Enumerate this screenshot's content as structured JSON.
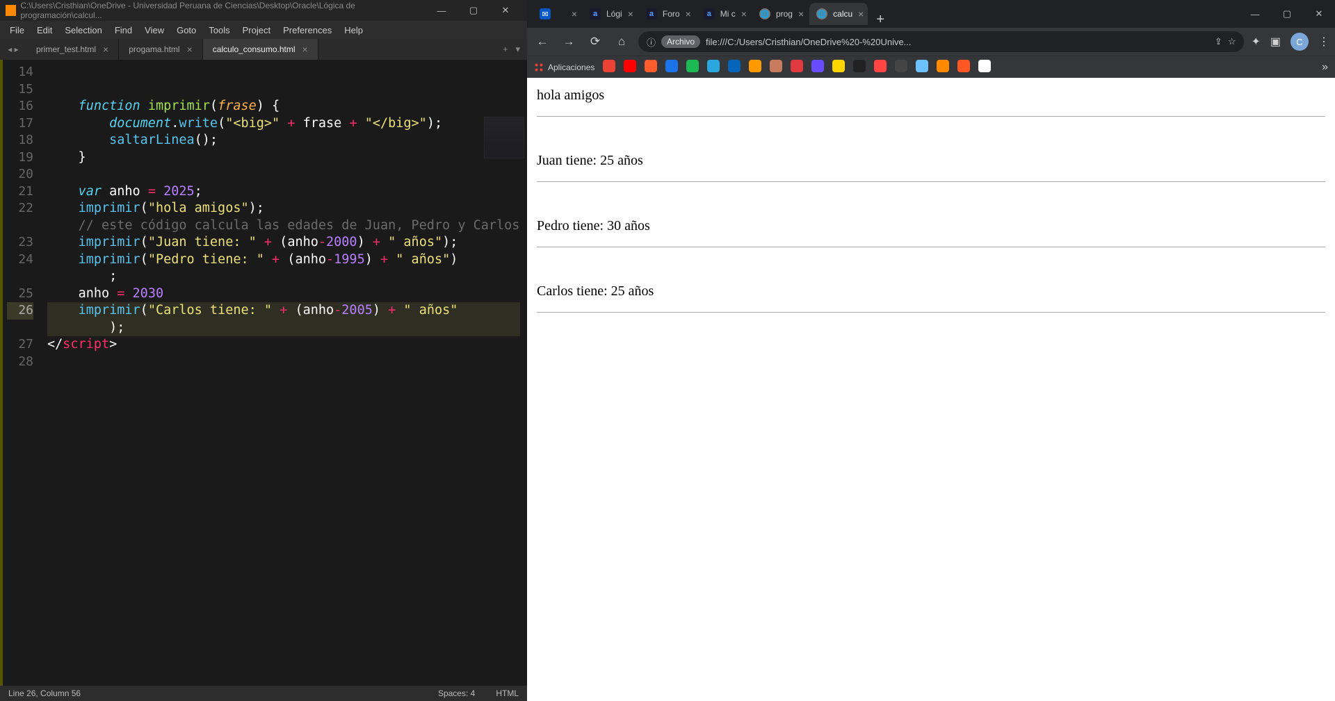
{
  "sublime": {
    "title": "C:\\Users\\Cristhian\\OneDrive - Universidad Peruana de Ciencias\\Desktop\\Oracle\\Lógica de programación\\calcul...",
    "menu": [
      "File",
      "Edit",
      "Selection",
      "Find",
      "View",
      "Goto",
      "Tools",
      "Project",
      "Preferences",
      "Help"
    ],
    "tabs": [
      {
        "label": "primer_test.html",
        "active": false
      },
      {
        "label": "progama.html",
        "active": false
      },
      {
        "label": "calculo_consumo.html",
        "active": true
      }
    ],
    "line_numbers": [
      "14",
      "15",
      "16",
      "17",
      "18",
      "19",
      "20",
      "21",
      "22",
      "",
      "23",
      "24",
      "",
      "25",
      "26",
      "",
      "27",
      "28"
    ],
    "highlight_row_index": 14,
    "status": {
      "left": "Line 26, Column 56",
      "spaces": "Spaces: 4",
      "syntax": "HTML"
    }
  },
  "code": {
    "l15_kw": "function",
    "l15_name": "imprimir",
    "l15_param": "frase",
    "l16_obj": "document",
    "l16_call": "write",
    "l16_s1": "\"<big>\"",
    "l16_s2": "\"</big>\"",
    "l16_var": "frase",
    "l17_call": "saltarLinea",
    "l20_kw": "var",
    "l20_name": "anho",
    "l20_num": "2025",
    "l21_call": "imprimir",
    "l21_str": "\"hola amigos\"",
    "l22_cmt": "// este código calcula las edades de Juan, Pedro y Carlos",
    "l23_call": "imprimir",
    "l23_s1": "\"Juan tiene: \"",
    "l23_var": "anho",
    "l23_num": "2000",
    "l23_s2": "\" años\"",
    "l24_call": "imprimir",
    "l24_s1": "\"Pedro tiene: \"",
    "l24_var": "anho",
    "l24_num": "1995",
    "l24_s2": "\" años\"",
    "l25_name": "anho",
    "l25_num": "2030",
    "l26_call": "imprimir",
    "l26_s1": "\"Carlos tiene: \"",
    "l26_var": "anho",
    "l26_num": "2005",
    "l26_s2": "\" años\"",
    "l28_tag": "script"
  },
  "chrome": {
    "tabs": [
      {
        "fav": "outlook",
        "label": ""
      },
      {
        "fav": "alura",
        "label": "Lógi"
      },
      {
        "fav": "alura",
        "label": "Foro"
      },
      {
        "fav": "alura",
        "label": "Mi c"
      },
      {
        "fav": "globe",
        "label": "prog"
      },
      {
        "fav": "globe",
        "label": "calcu",
        "active": true
      }
    ],
    "url_badge": "Archivo",
    "url": "file:///C:/Users/Cristhian/OneDrive%20-%20Unive...",
    "avatar": "C",
    "bookmarks_label": "Aplicaciones",
    "bookmark_colors": [
      "#ea4335",
      "#ff0000",
      "#ff5c2e",
      "#1a73e8",
      "#1db954",
      "#2aa7de",
      "#0364b8",
      "#ff9900",
      "#c97b5e",
      "#e03a3e",
      "#6a4cff",
      "#ffd600",
      "#222",
      "#f44",
      "#444",
      "#6ec1ff",
      "#ff8a00",
      "#ff5722",
      "#fff"
    ]
  },
  "page_output": [
    "hola amigos",
    "Juan tiene: 25 años",
    "Pedro tiene: 30 años",
    "Carlos tiene: 25 años"
  ]
}
